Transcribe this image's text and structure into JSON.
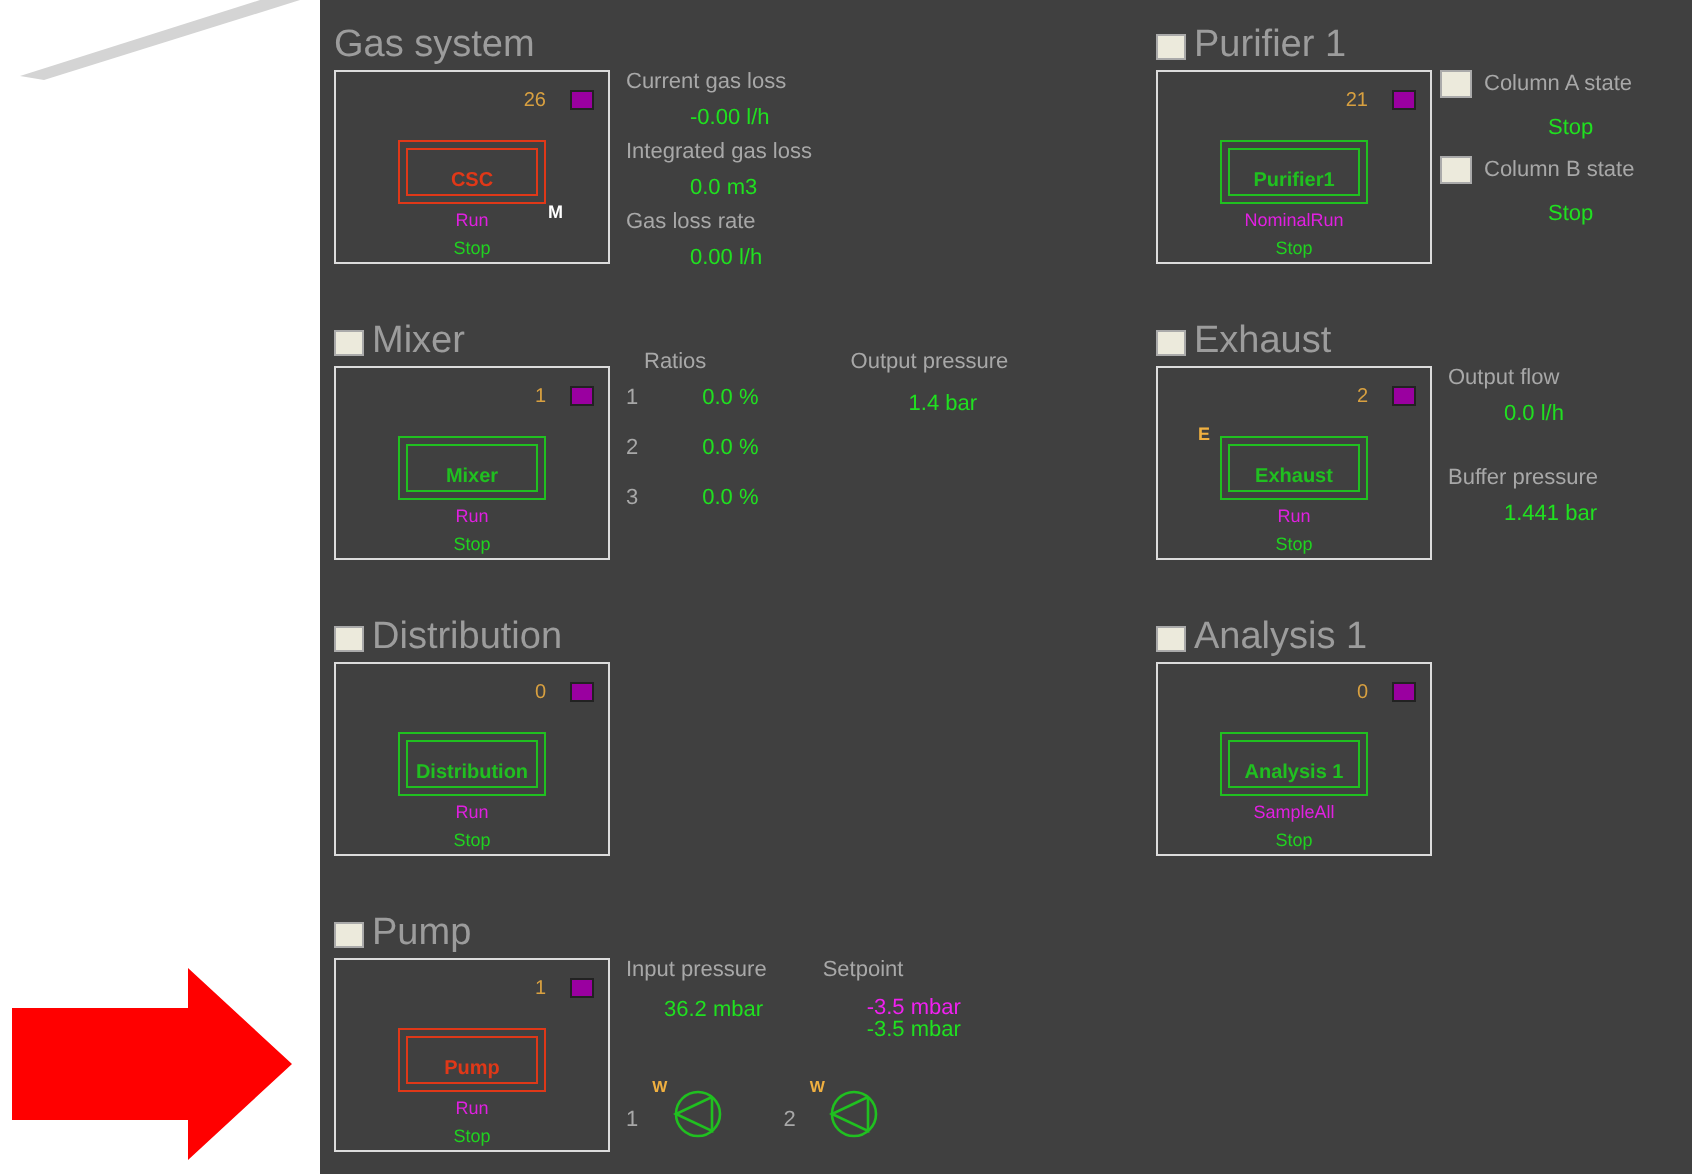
{
  "sections": [
    {
      "title": "Gas system",
      "toggle": false,
      "device": {
        "count": "26",
        "name": "CSC",
        "color": "#e03818",
        "mode": "Run",
        "state": "Stop",
        "marker": {
          "text": "M",
          "kind": "mode"
        }
      },
      "details": {
        "kind": "readings",
        "items": [
          {
            "label": "Current gas loss",
            "value": "-0.00 l/h"
          },
          {
            "label": "Integrated gas loss",
            "value": "0.0 m3"
          },
          {
            "label": "Gas loss rate",
            "value": "0.00 l/h"
          }
        ]
      }
    },
    {
      "title": "Purifier 1",
      "toggle": true,
      "device": {
        "count": "21",
        "name": "Purifier1",
        "color": "#20c020",
        "mode": "NominalRun",
        "state": "Stop"
      },
      "details": {
        "kind": "toggles",
        "items": [
          {
            "label": "Column A state",
            "value": "Stop"
          },
          {
            "label": "Column B state",
            "value": "Stop"
          }
        ]
      }
    },
    {
      "title": "Mixer",
      "toggle": true,
      "device": {
        "count": "1",
        "name": "Mixer",
        "color": "#20c020",
        "mode": "Run",
        "state": "Stop"
      },
      "details": {
        "kind": "mixer",
        "ratios_label": "Ratios",
        "ratios": [
          {
            "index": "1",
            "value": "0.0 %"
          },
          {
            "index": "2",
            "value": "0.0 %"
          },
          {
            "index": "3",
            "value": "0.0 %"
          }
        ],
        "output_label": "Output pressure",
        "output_value": "1.4 bar"
      }
    },
    {
      "title": "Exhaust",
      "toggle": true,
      "device": {
        "count": "2",
        "name": "Exhaust",
        "color": "#20c020",
        "mode": "Run",
        "state": "Stop",
        "marker": {
          "text": "E",
          "kind": "flag"
        }
      },
      "details": {
        "kind": "flow",
        "items": [
          {
            "label": "Output flow",
            "value": "0.0 l/h"
          },
          {
            "label": "Buffer pressure",
            "value": "1.441 bar"
          }
        ]
      }
    },
    {
      "title": "Distribution",
      "toggle": true,
      "device": {
        "count": "0",
        "name": "Distribution",
        "color": "#20c020",
        "mode": "Run",
        "state": "Stop"
      }
    },
    {
      "title": "Analysis 1",
      "toggle": true,
      "device": {
        "count": "0",
        "name": "Analysis 1",
        "color": "#20c020",
        "mode": "SampleAll",
        "state": "Stop"
      }
    },
    {
      "title": "Pump",
      "toggle": true,
      "device": {
        "count": "1",
        "name": "Pump",
        "color": "#e03818",
        "mode": "Run",
        "state": "Stop"
      },
      "details": {
        "kind": "pump",
        "input_label": "Input pressure",
        "input_value": "36.2 mbar",
        "setpoint_label": "Setpoint",
        "setpoints": [
          {
            "value": "-3.5 mbar",
            "kind": "target"
          },
          {
            "value": "-3.5 mbar",
            "kind": "actual"
          }
        ],
        "pumps": [
          {
            "index": "1",
            "flag": "W"
          },
          {
            "index": "2",
            "flag": "W"
          }
        ]
      }
    }
  ]
}
